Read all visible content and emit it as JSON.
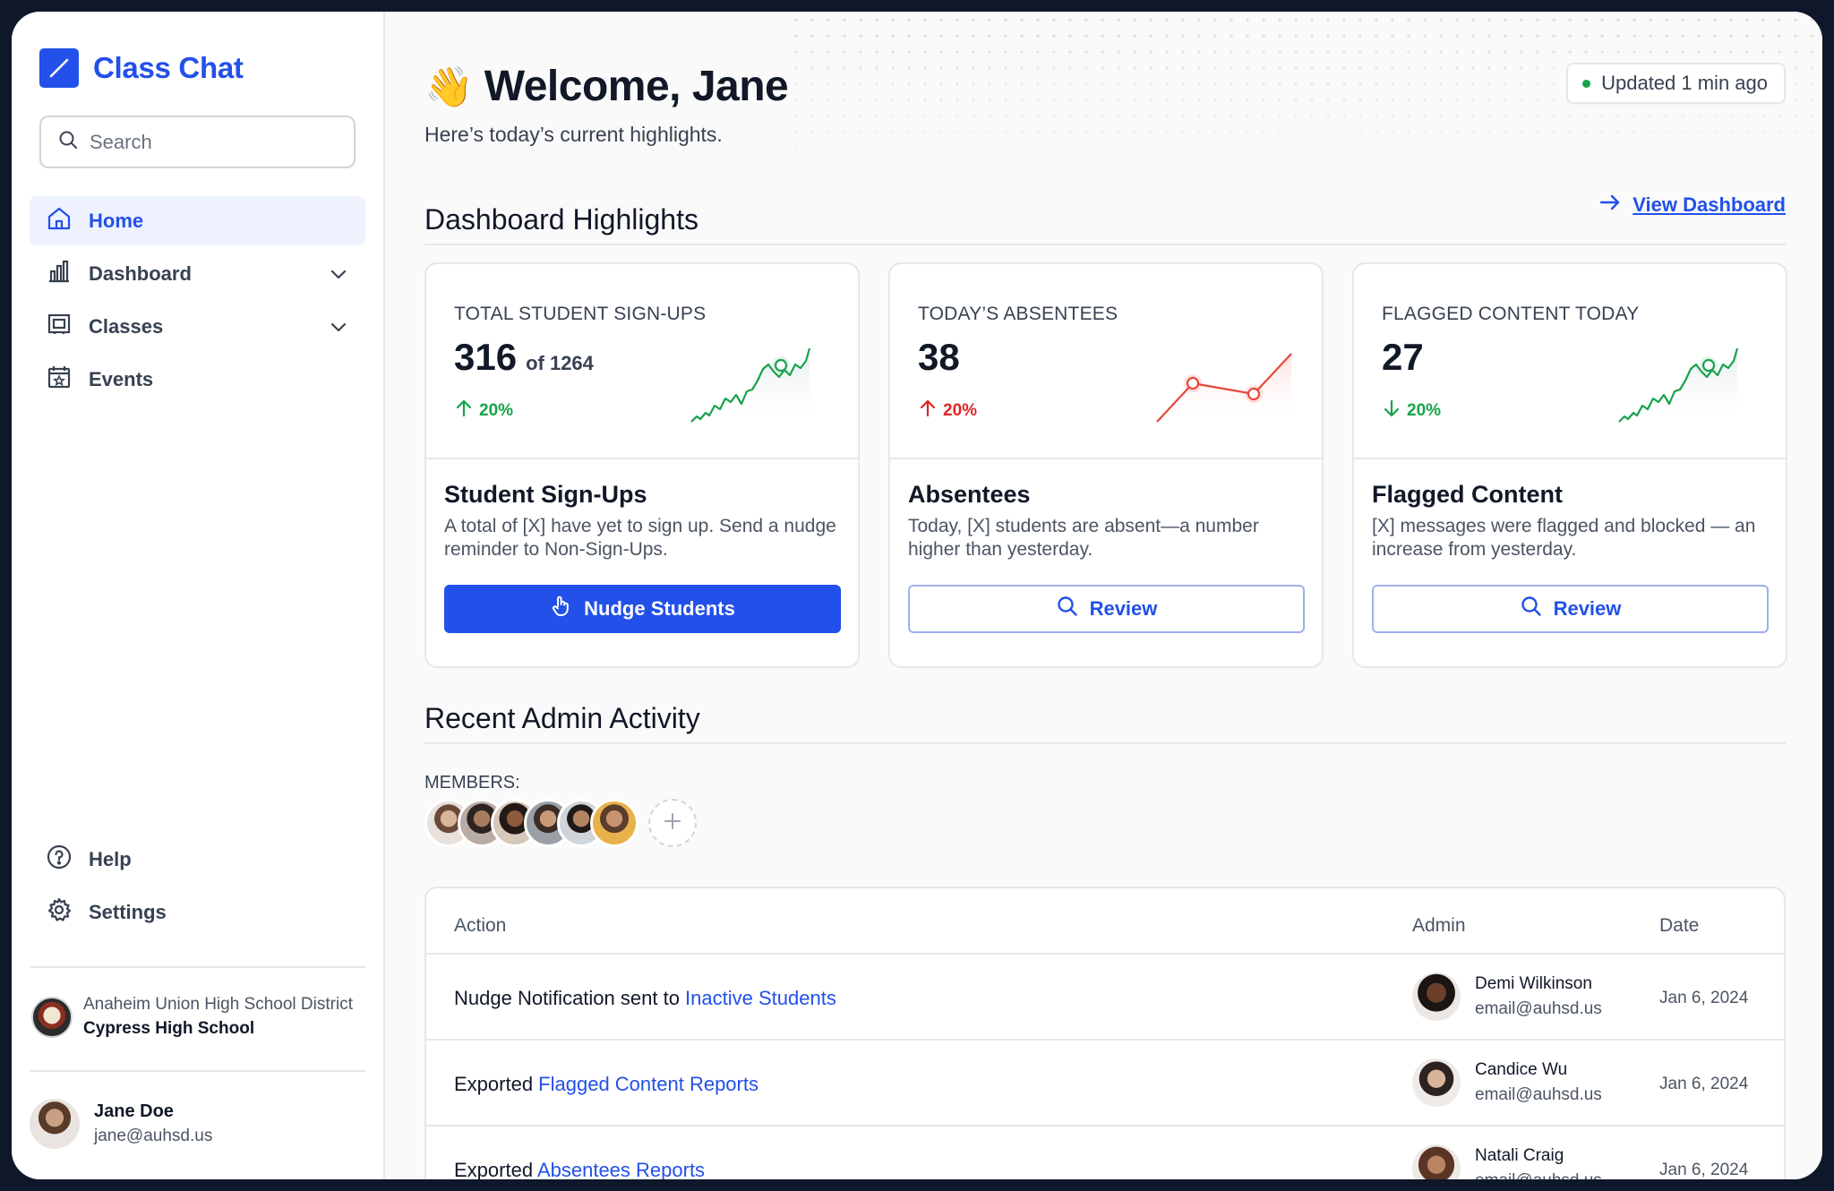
{
  "app": {
    "name": "Class Chat",
    "brand_color": "#2250e9"
  },
  "sidebar": {
    "search_placeholder": "Search",
    "nav": [
      {
        "label": "Home",
        "icon": "home-icon",
        "active": true
      },
      {
        "label": "Dashboard",
        "icon": "bar-chart-icon",
        "expandable": true
      },
      {
        "label": "Classes",
        "icon": "classroom-icon",
        "expandable": true
      },
      {
        "label": "Events",
        "icon": "calendar-star-icon"
      }
    ],
    "bottom_nav": [
      {
        "label": "Help",
        "icon": "help-circle-icon"
      },
      {
        "label": "Settings",
        "icon": "gear-icon"
      }
    ],
    "school": {
      "district": "Anaheim Union High School District",
      "name": "Cypress High School"
    },
    "user": {
      "name": "Jane Doe",
      "email": "jane@auhsd.us"
    }
  },
  "header": {
    "wave": "👋",
    "greeting": "Welcome, Jane",
    "subtitle": "Here’s today’s current highlights.",
    "updated": "Updated 1 min ago"
  },
  "highlights": {
    "title": "Dashboard Highlights",
    "view_link": "View Dashboard",
    "cards": [
      {
        "label": "TOTAL STUDENT SIGN-UPS",
        "value": "316",
        "of": "of 1264",
        "delta": "20%",
        "delta_direction": "up",
        "delta_color": "#16a34a",
        "trend_color": "#16a34a",
        "title": "Student Sign-Ups",
        "desc": "A total of [X] have yet to sign up. Send a nudge reminder to Non-Sign-Ups.",
        "button": "Nudge Students",
        "button_style": "primary",
        "button_icon": "hand-pointer-icon"
      },
      {
        "label": "TODAY’S ABSENTEES",
        "value": "38",
        "of": "",
        "delta": "20%",
        "delta_direction": "up",
        "delta_color": "#dc2626",
        "trend_color": "#e5483a",
        "title": "Absentees",
        "desc": "Today, [X] students are absent—a number higher than yesterday.",
        "button": "Review",
        "button_style": "outline",
        "button_icon": "search-icon"
      },
      {
        "label": "FLAGGED CONTENT TODAY",
        "value": "27",
        "of": "",
        "delta": "20%",
        "delta_direction": "down",
        "delta_color": "#16a34a",
        "trend_color": "#16a34a",
        "title": "Flagged Content",
        "desc": "[X] messages were flagged and blocked — an increase from yesterday.",
        "button": "Review",
        "button_style": "outline",
        "button_icon": "search-icon"
      }
    ]
  },
  "activity": {
    "title": "Recent Admin Activity",
    "members_label": "MEMBERS:",
    "member_count": 6,
    "add_member_icon": "plus-icon",
    "columns": [
      "Action",
      "Admin",
      "Date"
    ],
    "rows": [
      {
        "action_prefix": "Nudge Notification sent to ",
        "action_link": "Inactive Students",
        "admin_name": "Demi Wilkinson",
        "admin_email": "email@auhsd.us",
        "date": "Jan 6, 2024"
      },
      {
        "action_prefix": "Exported ",
        "action_link": "Flagged Content Reports",
        "admin_name": "Candice Wu",
        "admin_email": "email@auhsd.us",
        "date": "Jan 6, 2024"
      },
      {
        "action_prefix": "Exported ",
        "action_link": "Absentees Reports",
        "admin_name": "Natali Craig",
        "admin_email": "email@auhsd.us",
        "date": "Jan 6, 2024"
      }
    ]
  }
}
